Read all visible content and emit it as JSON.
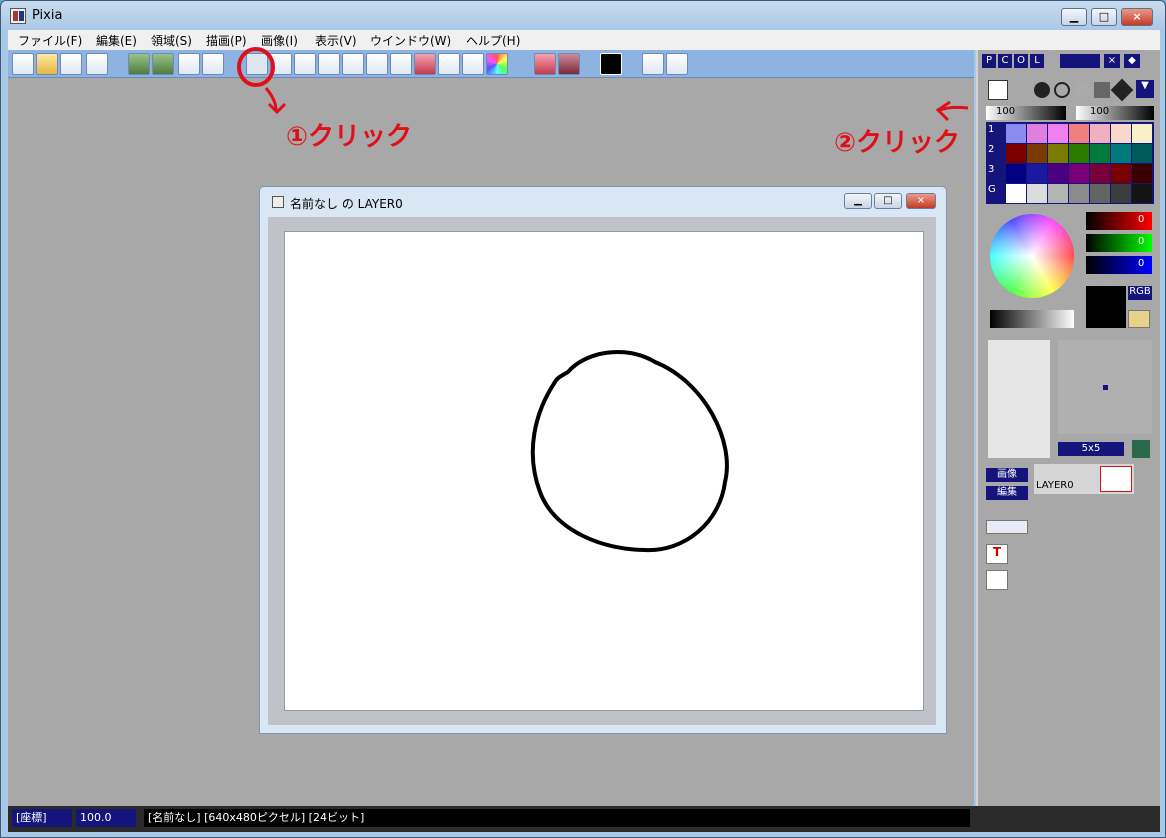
{
  "window": {
    "title": "Pixia",
    "minimize_icon": "minimize-icon",
    "maximize_icon": "maximize-icon",
    "close_label": "×"
  },
  "menu": [
    {
      "label": "ファイル(F)"
    },
    {
      "label": "編集(E)"
    },
    {
      "label": "領域(S)"
    },
    {
      "label": "描画(P)"
    },
    {
      "label": "画像(I)"
    },
    {
      "label": "表示(V)"
    },
    {
      "label": "ウインドウ(W)"
    },
    {
      "label": "ヘルプ(H)"
    }
  ],
  "document": {
    "title": "名前なし の LAYER0",
    "close_label": "×"
  },
  "panel": {
    "tabs": [
      "P",
      "C",
      "O",
      "L"
    ],
    "opacity_value": "100",
    "density_value": "100",
    "palette_rows": [
      "1",
      "2",
      "3",
      "G"
    ],
    "colors": {
      "row1": [
        "#8b8bf0",
        "#e07fe0",
        "#f07ff0",
        "#f08080",
        "#f0b0c0",
        "#f8d8c8",
        "#f8f0c8"
      ],
      "row2": [
        "#7a0000",
        "#7a3a00",
        "#7a7a00",
        "#2a7a00",
        "#007a3a",
        "#007a7a",
        "#005a5a"
      ],
      "row3": [
        "#000080",
        "#1a1aa0",
        "#4a0080",
        "#7a007a",
        "#7a003a",
        "#7a0000",
        "#3a0000"
      ],
      "rowG": [
        "#ffffff",
        "#dcdcdc",
        "#b4b4b4",
        "#8c8c8c",
        "#646464",
        "#3c3c3c",
        "#141414"
      ]
    },
    "r_value": "0",
    "g_value": "0",
    "b_value": "0",
    "color_mode": "RGB",
    "brush_size": "5x5",
    "layer_buttons": [
      "画像",
      "編集"
    ],
    "layer_name": "LAYER0"
  },
  "status": {
    "coord_label": "[座標]",
    "zoom": "100.0",
    "info": "[名前なし] [640x480ピクセル] [24ビット]"
  },
  "annotations": {
    "note1": "①クリック",
    "note2": "②クリック"
  }
}
